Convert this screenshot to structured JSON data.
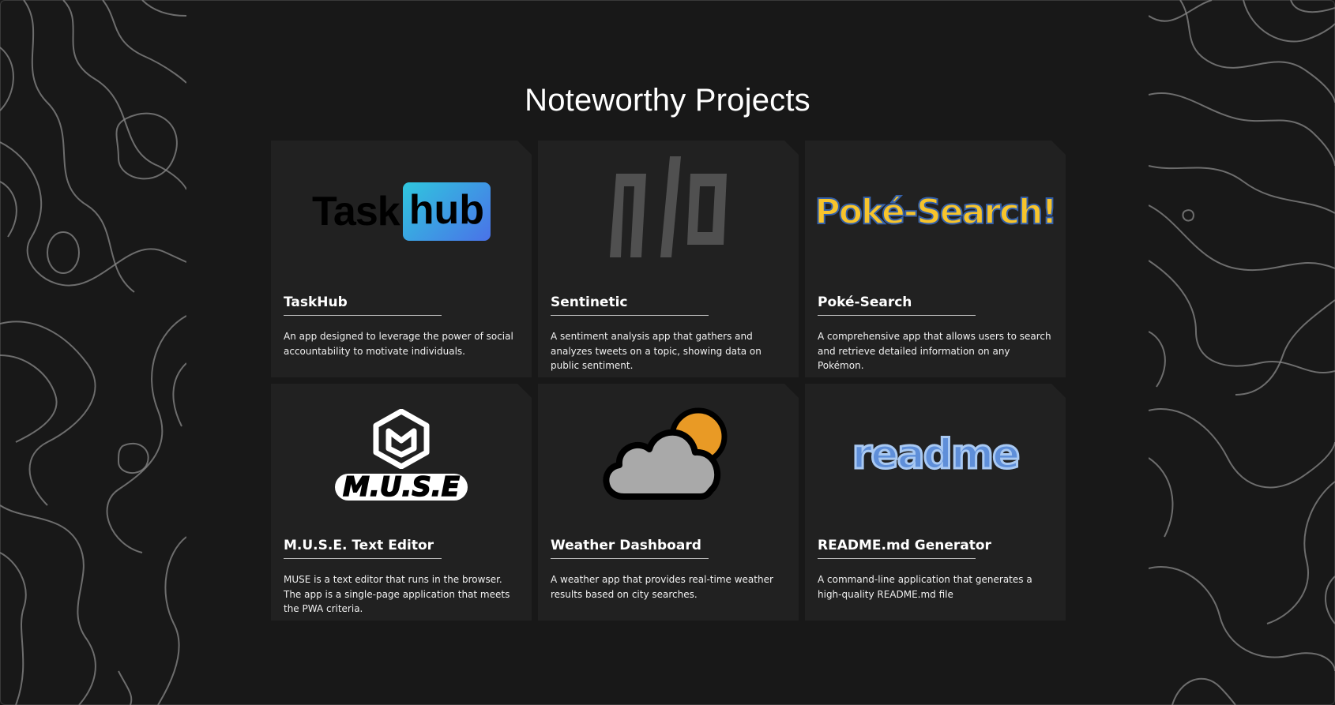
{
  "page": {
    "title": "Noteworthy Projects"
  },
  "projects": [
    {
      "name": "TaskHub",
      "logo_text": [
        "Task",
        "hub"
      ],
      "description": "An app designed to leverage the power of social accountability to motivate individuals."
    },
    {
      "name": "Sentinetic",
      "logo_text": "n/a",
      "description": "A sentiment analysis app that gathers and analyzes tweets on a topic, showing data on public sentiment."
    },
    {
      "name": "Poké-Search",
      "logo_text": "Poké-Search!",
      "description": "A comprehensive app that allows users to search and retrieve detailed information on any Pokémon."
    },
    {
      "name": "M.U.S.E. Text Editor",
      "logo_text": "M.U.S.E",
      "description": "MUSE is a text editor that runs in the browser. The app is a single-page application that meets the PWA criteria."
    },
    {
      "name": "Weather Dashboard",
      "logo_icon": "cloud-sun-icon",
      "description": "A weather app that provides real-time weather results based on city searches."
    },
    {
      "name": "README.md Generator",
      "logo_text": "readme",
      "description": "A command-line application that generates a high-quality README.md file"
    }
  ],
  "colors": {
    "background": "#181818",
    "card": "#212121",
    "taskhub_gradient": [
      "#2fc7de",
      "#4a72e8"
    ],
    "poke_yellow": "#f7c42c",
    "poke_blue": "#3560a8",
    "sun": "#e99a25",
    "cloud": "#a9a9a9",
    "readme_blue": "#5f8fd9"
  }
}
